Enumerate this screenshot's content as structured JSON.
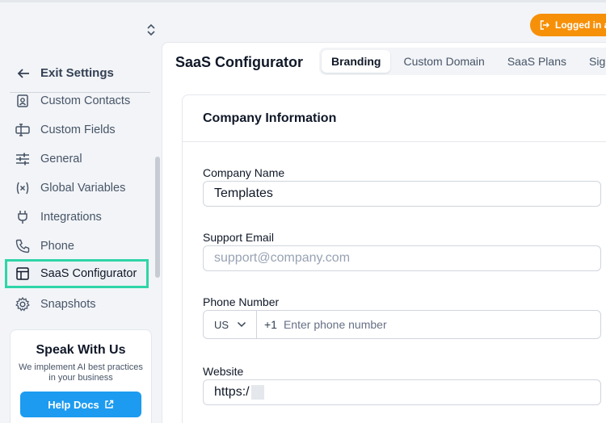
{
  "topbar": {
    "switcher": "⌃⌄",
    "logged_in": "Logged in a"
  },
  "sidebar": {
    "exit_label": "Exit Settings",
    "items": [
      {
        "label": "Custom Contacts",
        "icon": "contacts-icon"
      },
      {
        "label": "Custom Fields",
        "icon": "custom-fields-icon"
      },
      {
        "label": "General",
        "icon": "sliders-icon"
      },
      {
        "label": "Global Variables",
        "icon": "variables-icon"
      },
      {
        "label": "Integrations",
        "icon": "plug-icon"
      },
      {
        "label": "Phone",
        "icon": "phone-icon"
      },
      {
        "label": "SaaS Configurator",
        "icon": "layout-icon",
        "active": true
      },
      {
        "label": "Snapshots",
        "icon": "gear-icon"
      }
    ],
    "promo": {
      "title": "Speak With Us",
      "text": "We implement AI best practices in your business",
      "button": "Help Docs"
    }
  },
  "main": {
    "title": "SaaS Configurator",
    "tabs": [
      {
        "label": "Branding",
        "active": true
      },
      {
        "label": "Custom Domain"
      },
      {
        "label": "SaaS Plans"
      },
      {
        "label": "Sig"
      }
    ],
    "card": {
      "title": "Company Information",
      "company_name": {
        "label": "Company Name",
        "value": "Templates"
      },
      "support_email": {
        "label": "Support Email",
        "placeholder": "support@company.com"
      },
      "phone": {
        "label": "Phone Number",
        "country": "US",
        "dial_code": "+1",
        "placeholder": "Enter phone number"
      },
      "website": {
        "label": "Website",
        "value": "https:/"
      }
    }
  },
  "colors": {
    "accent": "#f79009",
    "active_outline": "#2fd5a8",
    "button": "#1d9bf0"
  }
}
